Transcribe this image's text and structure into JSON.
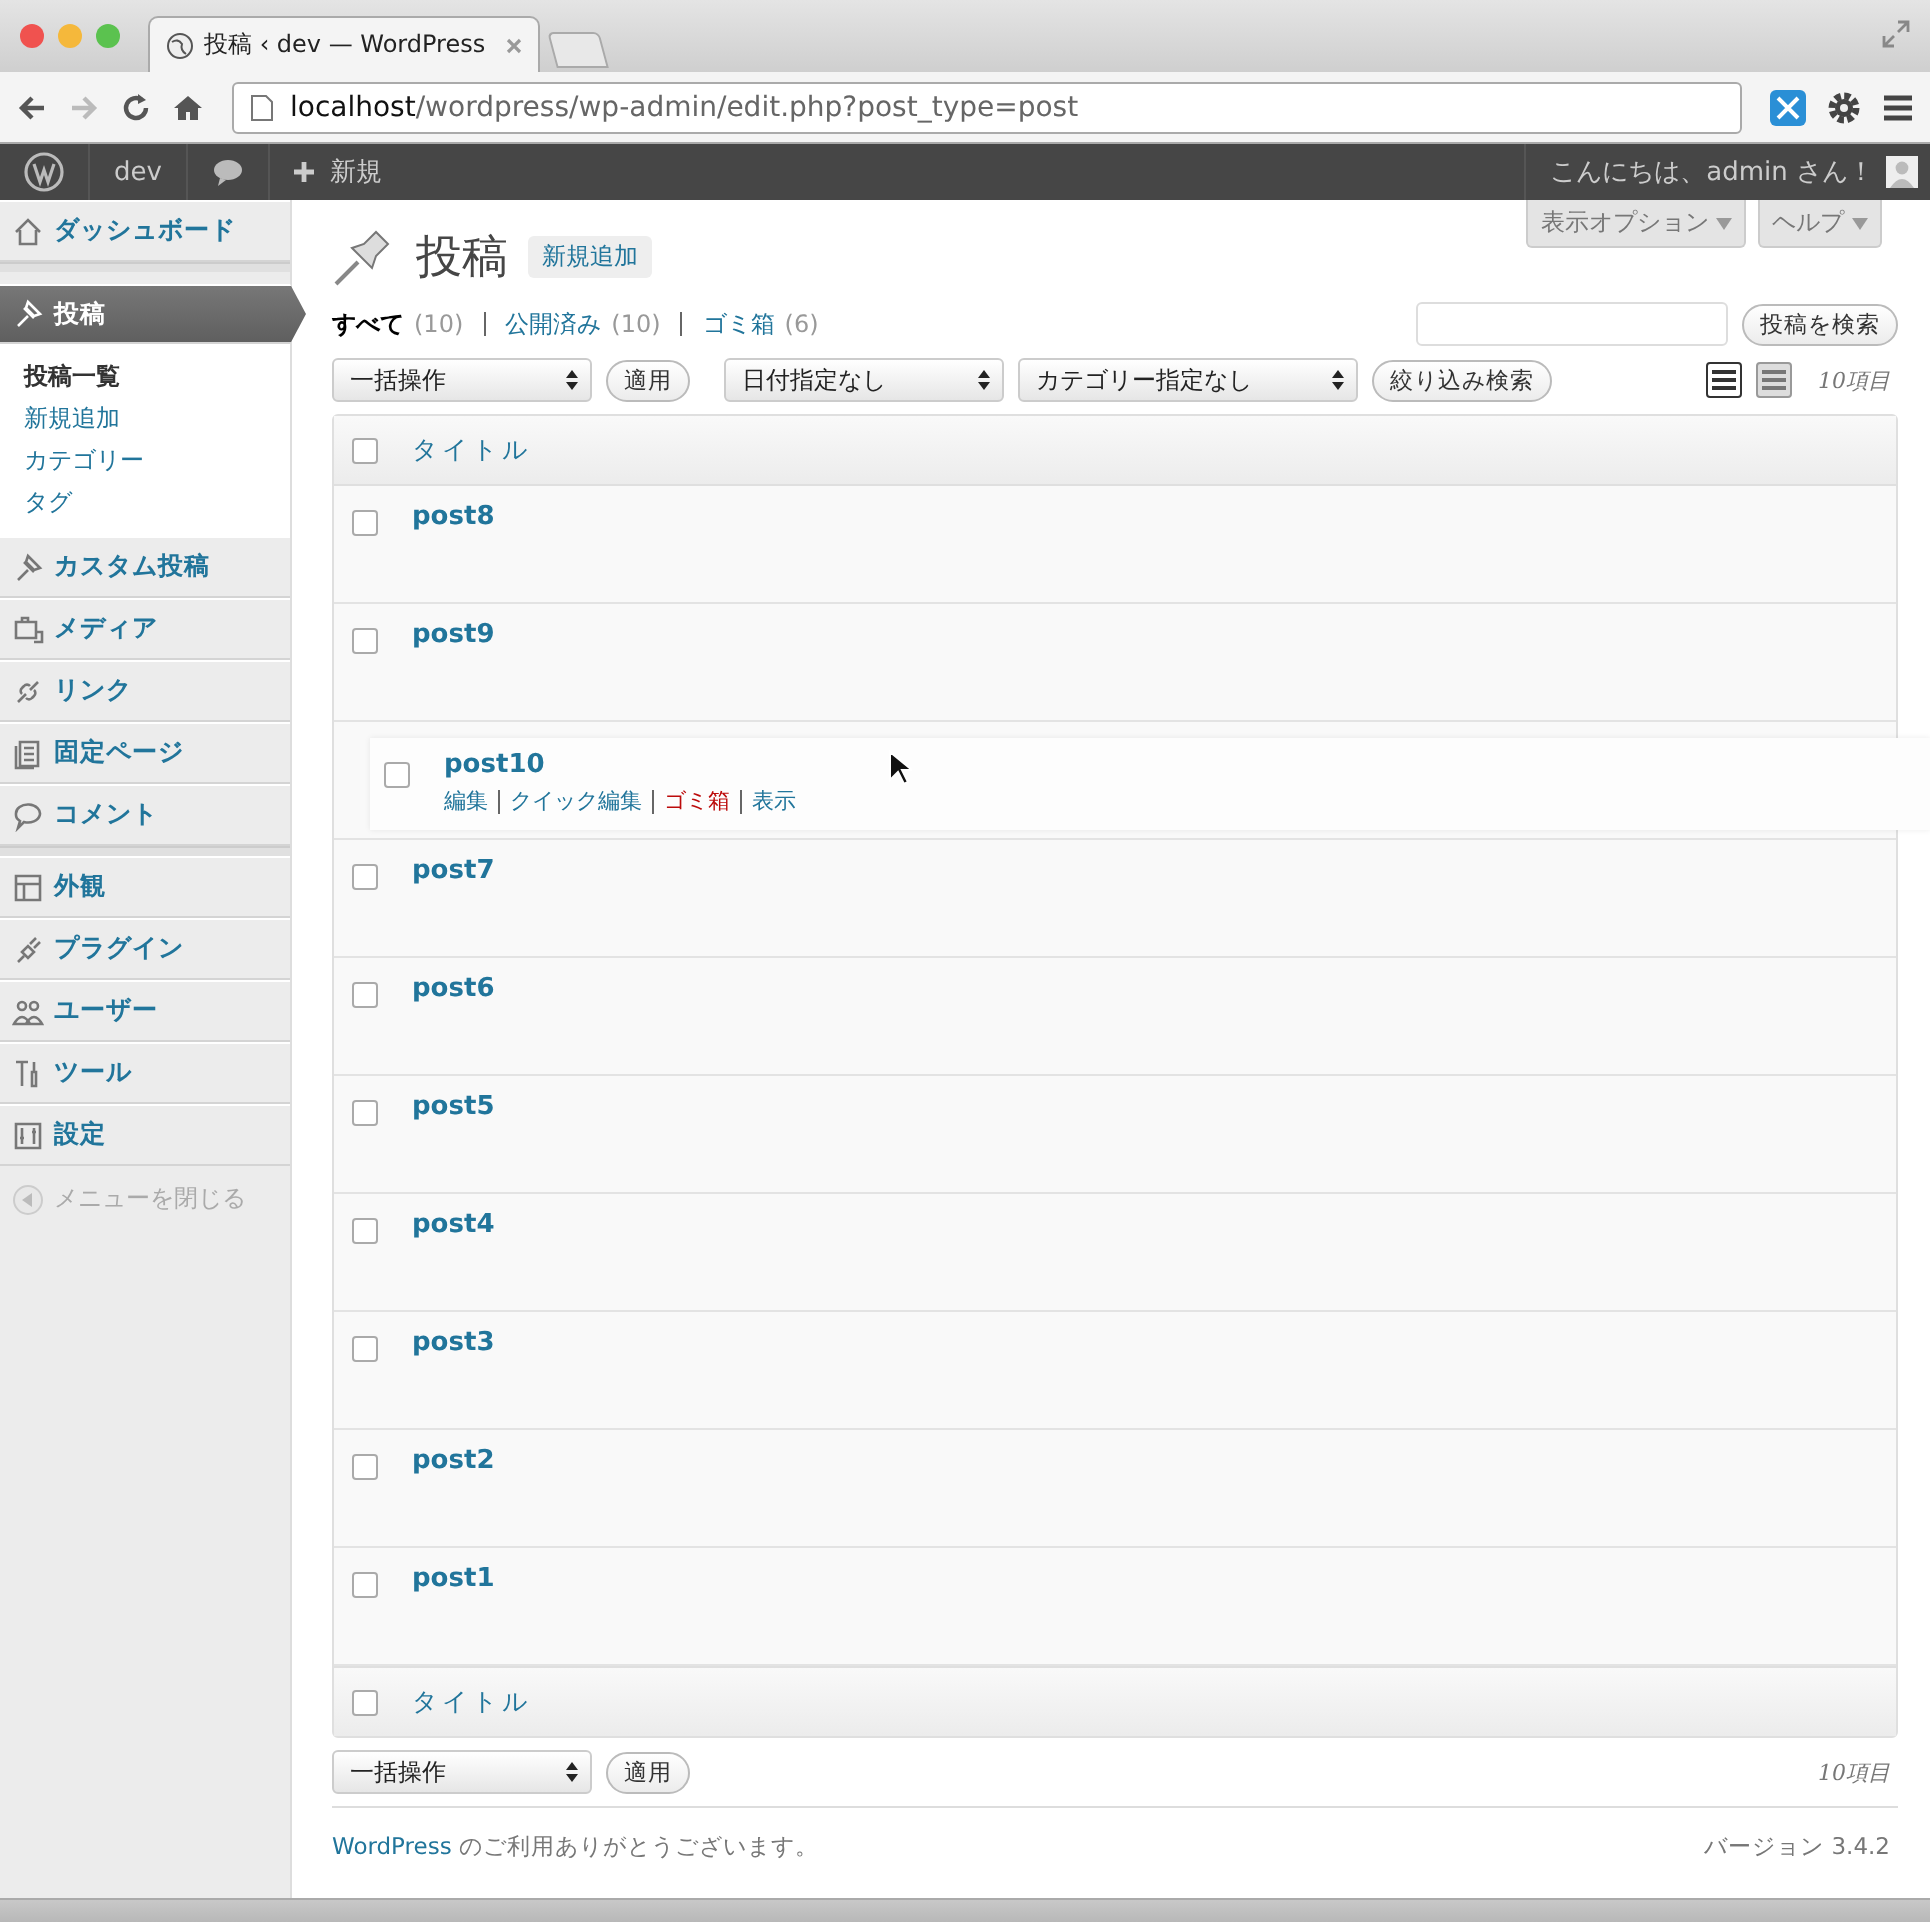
{
  "browser": {
    "tabs": [
      {
        "title": "投稿 ‹ dev — WordPress",
        "selected": true
      }
    ],
    "url_host": "localhost",
    "url_path": "/wordpress/wp-admin/edit.php?post_type=post"
  },
  "admin_bar": {
    "site": "dev",
    "new": "新規",
    "greeting": "こんにちは、admin さん！"
  },
  "sidebar": {
    "groups": [
      [
        {
          "label": "ダッシュボード",
          "selected": false
        }
      ],
      [
        {
          "label": "投稿",
          "selected": true,
          "children": [
            {
              "label": "投稿一覧",
              "selected": true
            },
            {
              "label": "新規追加",
              "selected": false
            },
            {
              "label": "カテゴリー",
              "selected": false
            },
            {
              "label": "タグ",
              "selected": false
            }
          ]
        },
        {
          "label": "カスタム投稿",
          "selected": false
        },
        {
          "label": "メディア",
          "selected": false
        },
        {
          "label": "リンク",
          "selected": false
        },
        {
          "label": "固定ページ",
          "selected": false
        },
        {
          "label": "コメント",
          "selected": false
        }
      ],
      [
        {
          "label": "外観",
          "selected": false
        },
        {
          "label": "プラグイン",
          "selected": false
        },
        {
          "label": "ユーザー",
          "selected": false
        },
        {
          "label": "ツール",
          "selected": false
        },
        {
          "label": "設定",
          "selected": false
        }
      ]
    ],
    "collapse": "メニューを閉じる"
  },
  "screen": {
    "title": "投稿",
    "add_new": "新規追加",
    "screen_options": "表示オプション",
    "help": "ヘルプ"
  },
  "filters": [
    {
      "label": "すべて",
      "count": "(10)",
      "selected": true
    },
    {
      "label": "公開済み",
      "count": "(10)",
      "selected": false
    },
    {
      "label": "ゴミ箱",
      "count": "(6)",
      "selected": false
    }
  ],
  "search_button": "投稿を検索",
  "top_nav": {
    "bulk": "一括操作",
    "apply": "適用",
    "date": "日付指定なし",
    "category": "カテゴリー指定なし",
    "filter": "絞り込み検索",
    "view_modes": [
      {
        "selected": true
      },
      {
        "selected": false
      }
    ],
    "count": "10項目"
  },
  "table": {
    "column": "タイトル",
    "select_all_checked": false,
    "rows": [
      {
        "title": "post8",
        "kind": "row",
        "checked": false
      },
      {
        "title": "post9",
        "kind": "row",
        "checked": false
      },
      {
        "title": "post10",
        "kind": "dragged",
        "checked": false,
        "actions": [
          {
            "label": "編集",
            "kind": "link"
          },
          {
            "label": "クイック編集",
            "kind": "link"
          },
          {
            "label": "ゴミ箱",
            "kind": "trash"
          },
          {
            "label": "表示",
            "kind": "link"
          }
        ]
      },
      {
        "title": "post7",
        "kind": "row",
        "checked": false
      },
      {
        "title": "post6",
        "kind": "row",
        "checked": false
      },
      {
        "title": "post5",
        "kind": "row",
        "checked": false
      },
      {
        "title": "post4",
        "kind": "row",
        "checked": false
      },
      {
        "title": "post3",
        "kind": "row",
        "checked": false
      },
      {
        "title": "post2",
        "kind": "row",
        "checked": false
      },
      {
        "title": "post1",
        "kind": "row",
        "checked": false
      }
    ],
    "footer_column": "タイトル",
    "footer_select_all_checked": false
  },
  "bottom_nav": {
    "bulk": "一括操作",
    "apply": "適用",
    "count": "10項目"
  },
  "footer": {
    "link": "WordPress",
    "text": "のご利用ありがとうございます。",
    "version": "バージョン 3.4.2"
  }
}
